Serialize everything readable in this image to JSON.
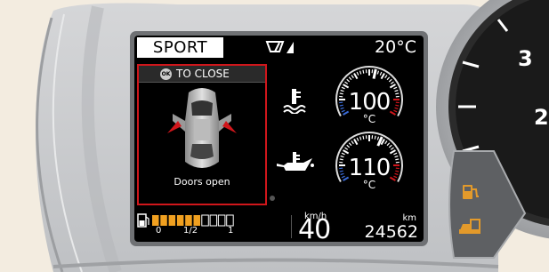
{
  "colors": {
    "background": "#f3ece0",
    "bezel": "#d8d9da",
    "display": "#000000",
    "alert_red": "#d0161b",
    "fuel_orange": "#f0a020",
    "warning_amber": "#e39a2b"
  },
  "header": {
    "drive_mode": "SPORT",
    "wiper_icon": "wiper-auto-icon",
    "outside_temp": "20°C"
  },
  "alert": {
    "ok_badge": "OK",
    "dismiss_label": "TO CLOSE",
    "message": "Doors open",
    "icon": "car-doors-open-icon"
  },
  "gauges": [
    {
      "name": "coolant-temperature",
      "icon": "coolant-temp-icon",
      "value": "100",
      "unit": "°C",
      "level": 0.55
    },
    {
      "name": "oil-temperature",
      "icon": "oil-temp-icon",
      "value": "110",
      "unit": "°C",
      "level": 0.6
    }
  ],
  "fuel": {
    "icon": "fuel-pump-icon",
    "level_fraction": 0.6,
    "segments_total": 10,
    "labels": [
      "0",
      "1/2",
      "1"
    ]
  },
  "speed": {
    "unit": "km/h",
    "value": "40"
  },
  "odometer": {
    "unit": "km",
    "value": "24562"
  },
  "tachometer": {
    "visible_numbers": [
      "3",
      "2"
    ]
  },
  "warning_lights": [
    "fuel-low-icon",
    "door-ajar-icon"
  ]
}
